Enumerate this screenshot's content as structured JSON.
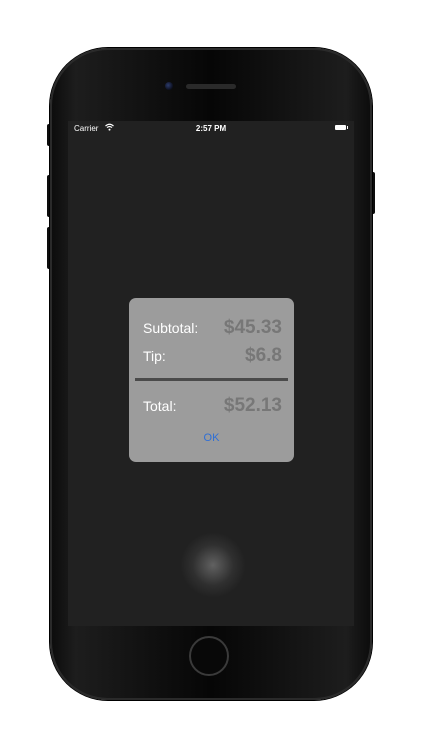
{
  "status_bar": {
    "carrier": "Carrier",
    "wifi_icon": "wifi-icon",
    "time": "2:57 PM",
    "battery_icon": "battery-icon"
  },
  "dialog": {
    "subtotal_label": "Subtotal:",
    "subtotal_value": "$45.33",
    "tip_label": "Tip:",
    "tip_value": "$6.8",
    "total_label": "Total:",
    "total_value": "$52.13",
    "ok_label": "OK"
  },
  "colors": {
    "screen_background": "#212121",
    "dialog_background": "#9c9c9c",
    "value_text": "#777777",
    "ok_accent": "#2f6fd6"
  }
}
